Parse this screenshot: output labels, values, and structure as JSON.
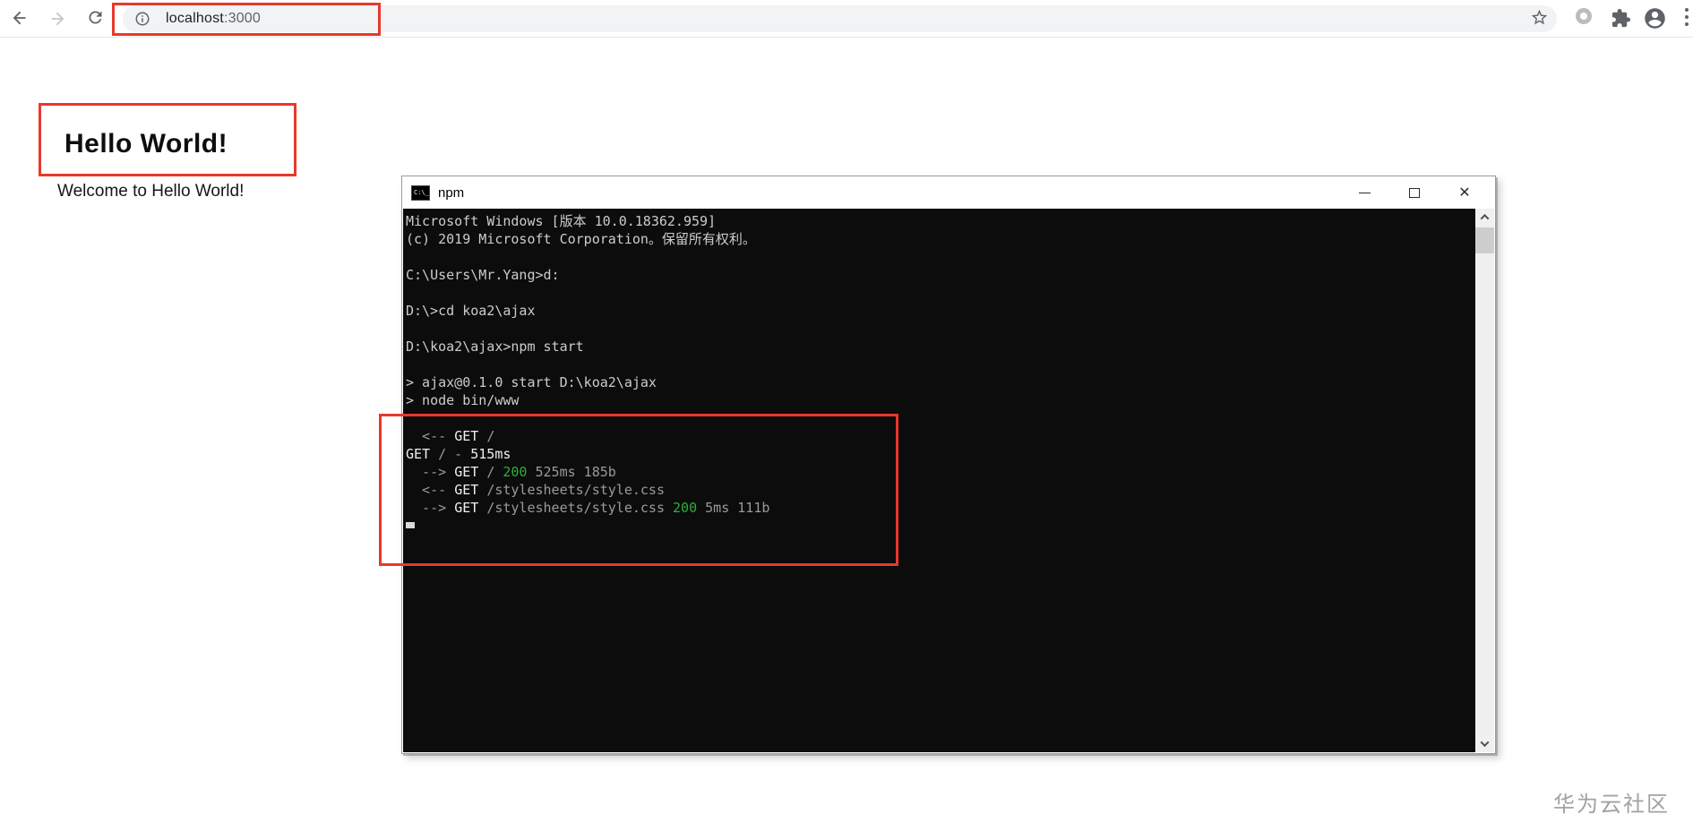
{
  "browser": {
    "url": {
      "host": "localhost",
      "port": ":3000"
    },
    "icons": [
      "back-arrow",
      "forward-arrow",
      "refresh",
      "info",
      "bookmark-star",
      "extension-ring",
      "extensions-puzzle",
      "profile-avatar",
      "kebab-menu"
    ]
  },
  "page": {
    "title": "Hello World!",
    "subtitle": "Welcome to Hello World!"
  },
  "watermark": "华为云社区",
  "terminal": {
    "title": "npm",
    "controls": {
      "minimize": "minimize",
      "maximize": "maximize",
      "close": "✕"
    },
    "lines": [
      {
        "segments": [
          [
            "Microsoft Windows [版本 10.0.18362.959]",
            "fg"
          ]
        ]
      },
      {
        "segments": [
          [
            "(c) 2019 Microsoft Corporation。保留所有权利。",
            "fg"
          ]
        ]
      },
      {
        "segments": []
      },
      {
        "segments": [
          [
            "C:\\Users\\Mr.Yang>d:",
            "fg"
          ]
        ]
      },
      {
        "segments": []
      },
      {
        "segments": [
          [
            "D:\\>cd koa2\\ajax",
            "fg"
          ]
        ]
      },
      {
        "segments": []
      },
      {
        "segments": [
          [
            "D:\\koa2\\ajax>npm start",
            "fg"
          ]
        ]
      },
      {
        "segments": []
      },
      {
        "segments": [
          [
            "> ajax@0.1.0 start D:\\koa2\\ajax",
            "fg"
          ]
        ]
      },
      {
        "segments": [
          [
            "> node bin/www",
            "fg"
          ]
        ]
      },
      {
        "segments": []
      },
      {
        "segments": [
          [
            "  <-- ",
            "dim"
          ],
          [
            "GET ",
            "bright"
          ],
          [
            "/",
            "dim"
          ]
        ]
      },
      {
        "segments": [
          [
            "GET ",
            "bright"
          ],
          [
            "/ - ",
            "dim"
          ],
          [
            "515ms",
            "bright"
          ]
        ]
      },
      {
        "segments": [
          [
            "  --> ",
            "dim"
          ],
          [
            "GET ",
            "bright"
          ],
          [
            "/ ",
            "dim"
          ],
          [
            "200",
            "ok"
          ],
          [
            " 525ms 185b",
            "dim"
          ]
        ]
      },
      {
        "segments": [
          [
            "  <-- ",
            "dim"
          ],
          [
            "GET ",
            "bright"
          ],
          [
            "/stylesheets/style.css",
            "dim"
          ]
        ]
      },
      {
        "segments": [
          [
            "  --> ",
            "dim"
          ],
          [
            "GET ",
            "bright"
          ],
          [
            "/stylesheets/style.css ",
            "dim"
          ],
          [
            "200",
            "ok"
          ],
          [
            " 5ms 111b",
            "dim"
          ]
        ]
      },
      {
        "segments": [],
        "cursor": true
      }
    ]
  },
  "colors": {
    "highlight_red": "#e8382c",
    "terminal_bg": "#0c0c0c",
    "terminal_fg": "#cccccc",
    "terminal_dim": "#9a9a9a",
    "terminal_bright": "#f0f0f0",
    "terminal_green": "#2fae39",
    "chrome_icon_gray": "#5f6368",
    "omnibox_bg": "#f1f3f4"
  }
}
